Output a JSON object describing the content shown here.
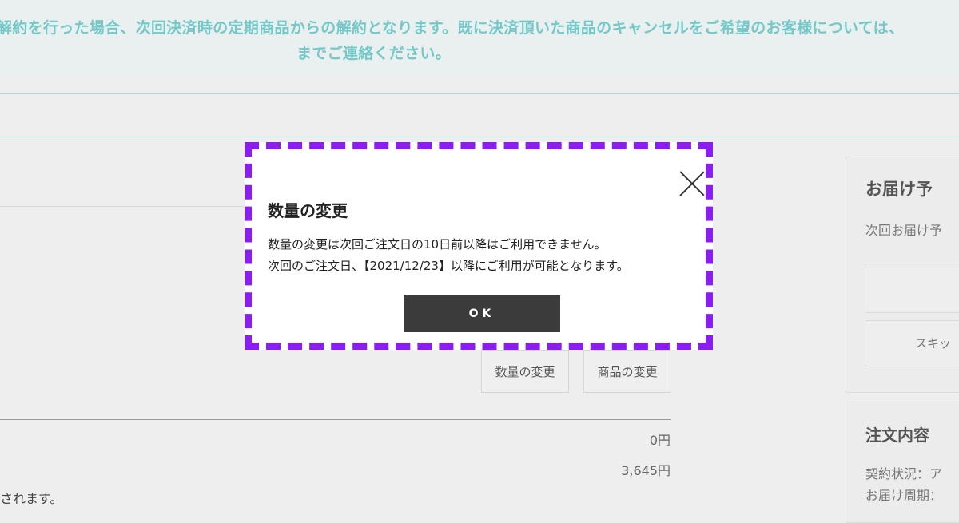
{
  "notice": {
    "line1": "解約を行った場合、次回決済時の定期商品からの解約となります。既に決済頂いた商品のキャンセルをご希望のお客様については、",
    "line2": "までご連絡ください。"
  },
  "order": {
    "buttons": {
      "change_quantity": "数量の変更",
      "change_product": "商品の変更"
    },
    "price_zero": "0円",
    "price_total": "3,645円",
    "partial_note": "されます。"
  },
  "sidebar": {
    "delivery_card": {
      "title": "お届け予",
      "subtitle": "次回お届け予",
      "skip_label": "スキッ"
    },
    "order_card": {
      "title": "注文内容",
      "status_label": "契約状況：ア",
      "cycle_label": "お届け周期："
    }
  },
  "modal": {
    "title": "数量の変更",
    "message_line1": "数量の変更は次回ご注文日の10日前以降はご利用できません。",
    "message_line2": "次回のご注文日、【2021/12/23】以降にご利用が可能となります。",
    "ok_label": "OK",
    "frame_color": "#8a1df0"
  }
}
